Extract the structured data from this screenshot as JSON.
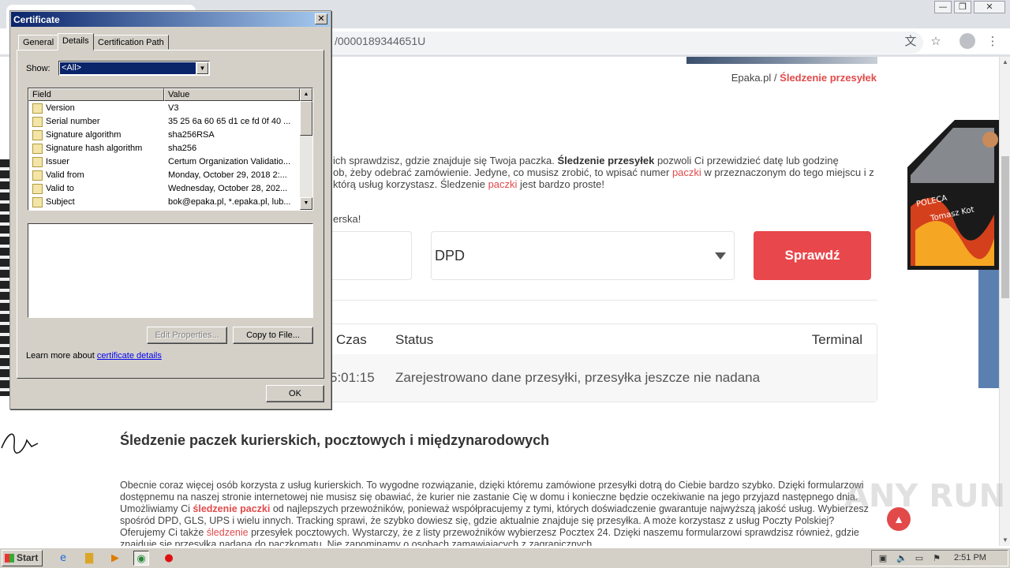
{
  "browser": {
    "url": "/0000189344651U",
    "window_buttons": [
      "—",
      "❐",
      "✕"
    ],
    "icons": [
      "translate-icon",
      "star-icon",
      "profile-icon",
      "menu-icon"
    ]
  },
  "page": {
    "breadcrumb": {
      "home": "Epaka.pl",
      "separator": "/",
      "current": "Śledzenie przesyłek"
    },
    "intro_parts": {
      "p1": "ich sprawdzisz, gdzie znajduje się Twoja paczka.",
      "b1": "Śledzenie przesyłek",
      "p2": "pozwoli Ci przewidzieć datę lub godzinę",
      "line2a": "ob, żeby odebrać zamówienie. Jedyne, co musisz zrobić, to wpisać numer",
      "red1": "paczki",
      "line2b": "w przeznaczonym do tego miejscu i z",
      "line3a": "którą usług korzystasz. Śledzenie",
      "red2": "paczki",
      "line3b": "jest bardzo proste!"
    },
    "fragment": "erska!",
    "carrier_select": {
      "value": "DPD"
    },
    "check_button": "Sprawdź",
    "tracking": {
      "headers": {
        "time": "Czas",
        "status": "Status",
        "terminal": "Terminal"
      },
      "row": {
        "time": "5:01:15",
        "status": "Zarejestrowano dane przesyłki, przesyłka jeszcze nie nadana",
        "terminal": ""
      }
    },
    "section_title": "Śledzenie paczek kurierskich, pocztowych i międzynarodowych",
    "article": {
      "s1": "Obecnie coraz więcej osób korzysta z usług kurierskich. To wygodne rozwiązanie, dzięki któremu zamówione przesyłki dotrą do Ciebie bardzo szybko. Dzięki formularzowi dostępnemu na naszej stronie internetowej nie musisz się obawiać, że kurier nie zastanie Cię w domu i konieczne będzie oczekiwanie na jego przyjazd następnego dnia. Umożliwiamy Ci",
      "red1": "śledzenie paczki",
      "s2": "od najlepszych przewoźników, ponieważ współpracujemy z tymi, których doświadczenie gwarantuje najwyższą jakość usług. Wybierzesz spośród DPD, GLS, UPS i wielu innych. Tracking sprawi, że szybko dowiesz się, gdzie aktualnie znajduje się przesyłka. A może korzystasz z usług Poczty Polskiej? Oferujemy Ci także",
      "red2": "śledzenie",
      "s3": "przesyłek pocztowych. Wystarczy, że z listy przewoźników wybierzesz Pocztex 24. Dzięki naszemu formularzowi sprawdzisz również, gdzie znajduje się przesyłka nadana do paczkomatu. Nie zapominamy o osobach zamawiających z zagranicznych"
    },
    "door_text": [
      "POLECA",
      "Tomasz Kot"
    ]
  },
  "dialog": {
    "title": "Certificate",
    "close": "✕",
    "tabs": [
      "General",
      "Details",
      "Certification Path"
    ],
    "active_tab": "Details",
    "show_label": "Show:",
    "show_value": "<All>",
    "columns": {
      "field": "Field",
      "value": "Value"
    },
    "rows": [
      {
        "field": "Version",
        "value": "V3"
      },
      {
        "field": "Serial number",
        "value": "35 25 6a 60 65 d1 ce fd 0f 40 ..."
      },
      {
        "field": "Signature algorithm",
        "value": "sha256RSA"
      },
      {
        "field": "Signature hash algorithm",
        "value": "sha256"
      },
      {
        "field": "Issuer",
        "value": "Certum Organization Validatio..."
      },
      {
        "field": "Valid from",
        "value": "Monday, October 29, 2018 2:..."
      },
      {
        "field": "Valid to",
        "value": "Wednesday, October 28, 202..."
      },
      {
        "field": "Subject",
        "value": "bok@epaka.pl, *.epaka.pl, lub..."
      }
    ],
    "edit_properties": "Edit Properties...",
    "copy_to_file": "Copy to File...",
    "learn_prefix": "Learn more about",
    "learn_link": "certificate details",
    "ok": "OK"
  },
  "taskbar": {
    "start": "Start",
    "clock": "2:51 PM"
  },
  "watermark": "ANY RUN"
}
